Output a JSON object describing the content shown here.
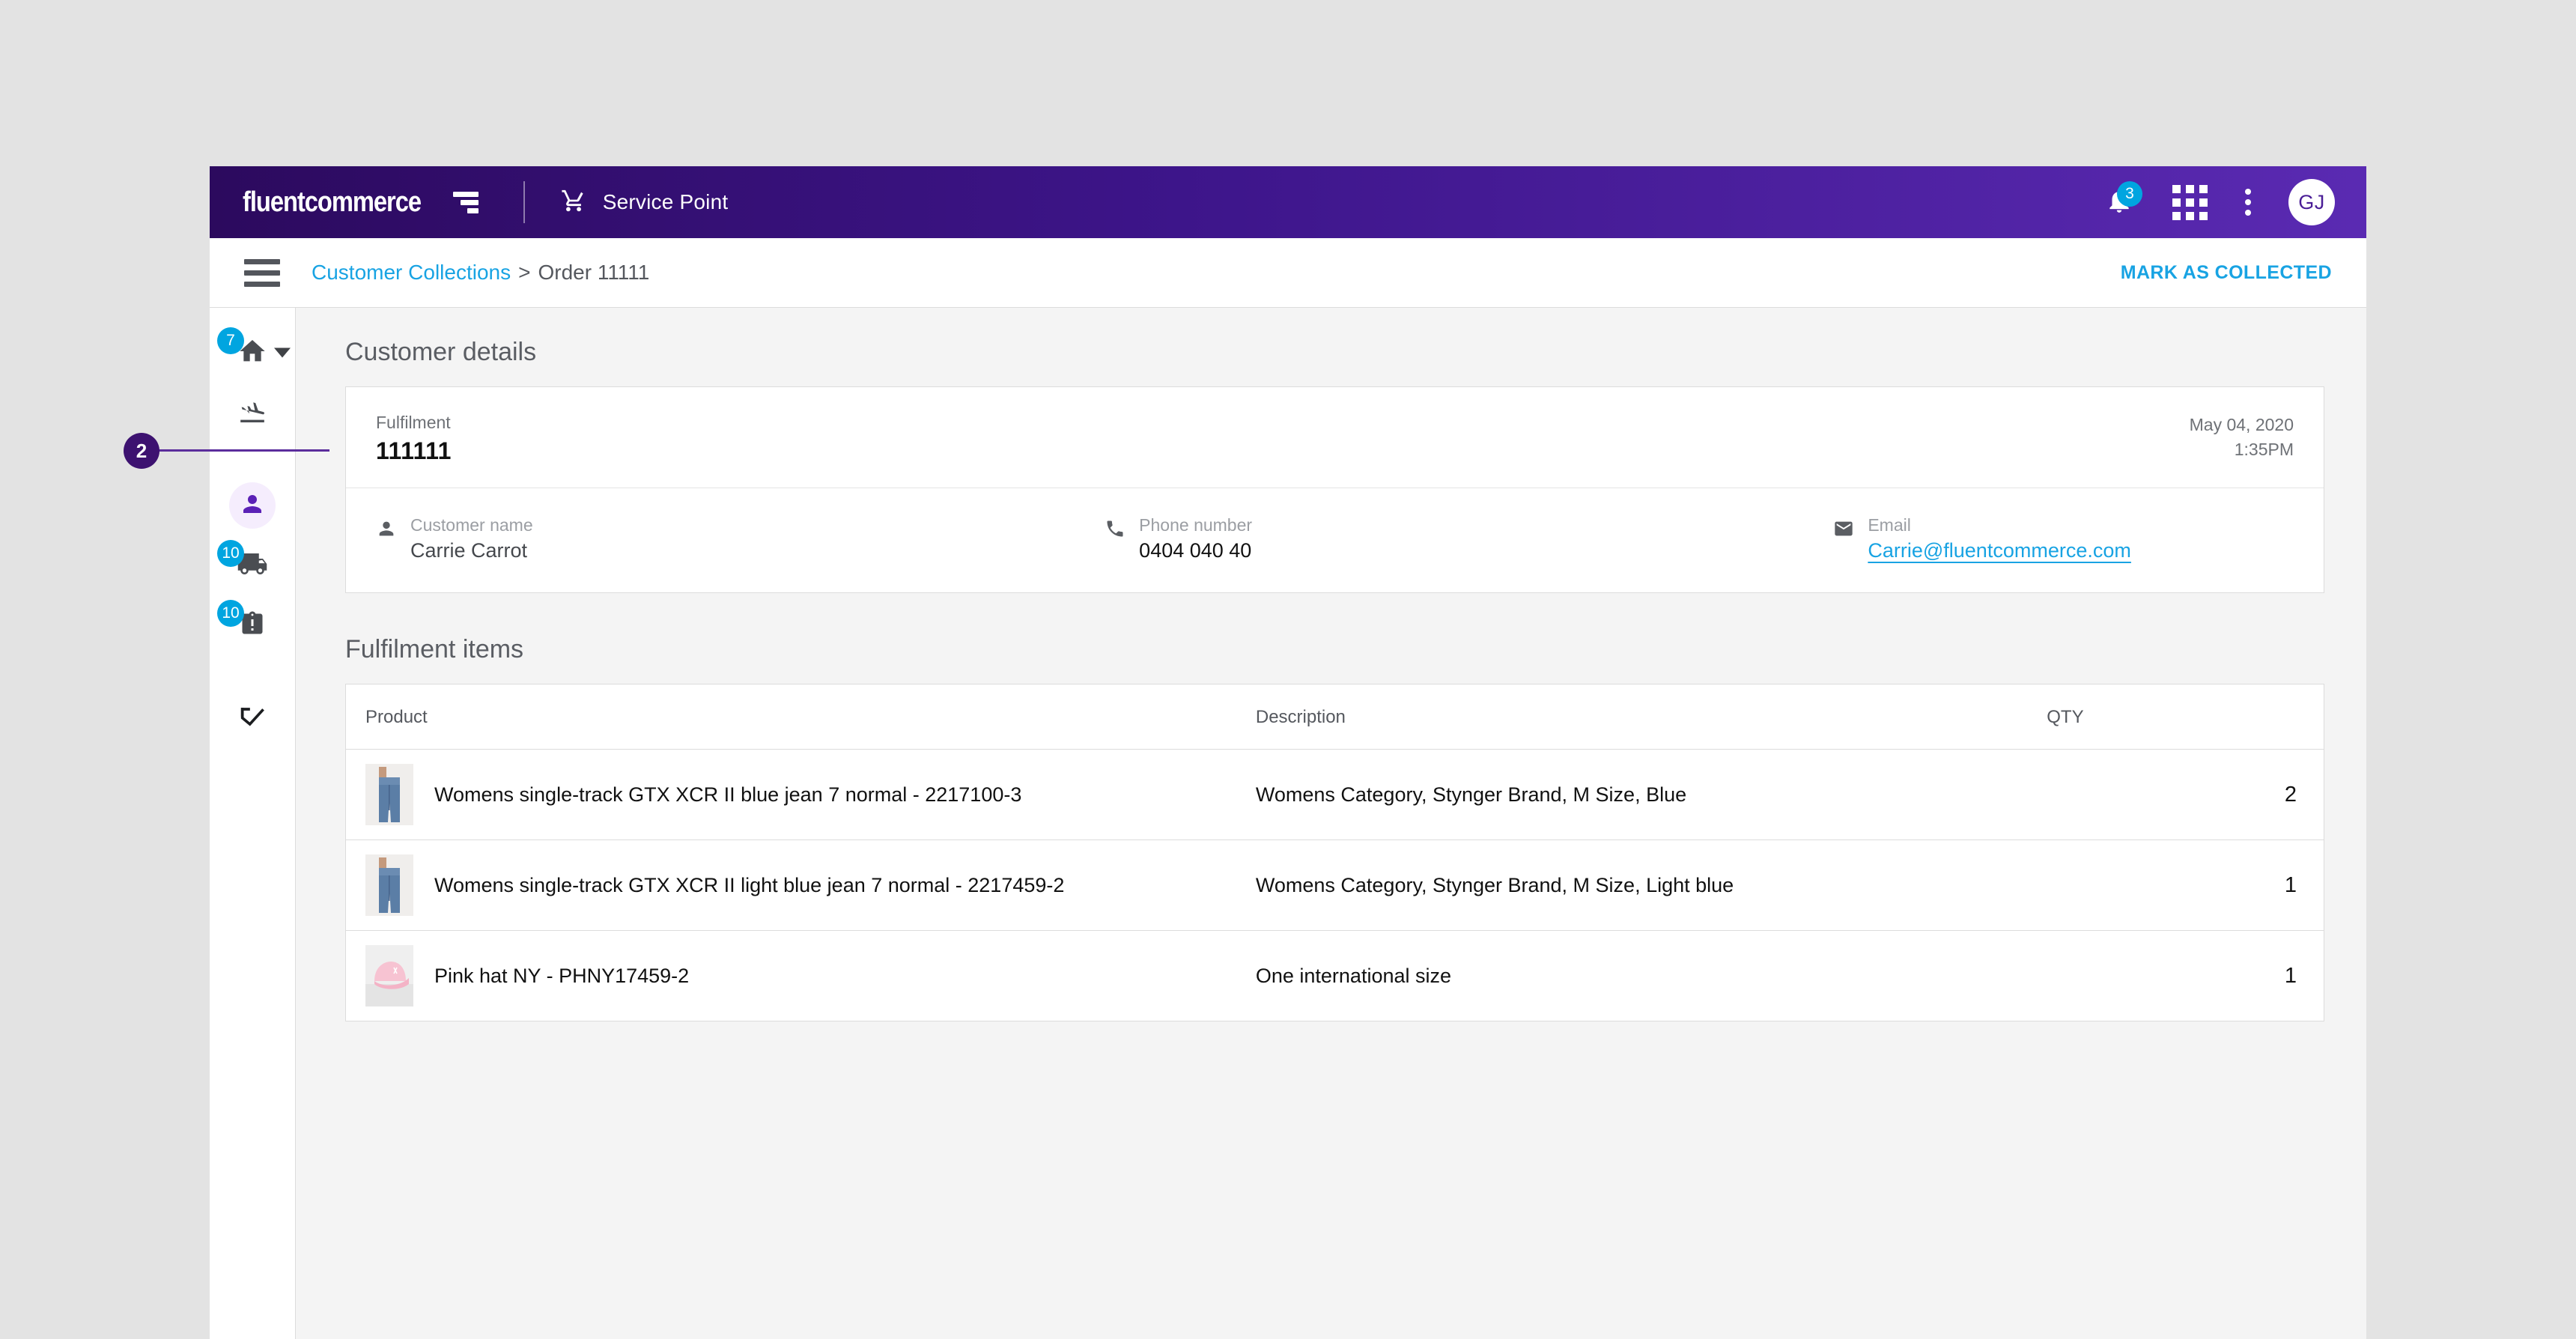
{
  "topbar": {
    "logo_text": "fluentcommerce",
    "logo_mark": "fluent-logo-mark",
    "app_name": "Service Point",
    "cart_icon": "shopping-cart-icon",
    "notification_count": "3",
    "bell_icon": "bell-icon",
    "apps_icon": "apps-grid-icon",
    "overflow_icon": "more-vertical-icon",
    "avatar_initials": "GJ"
  },
  "breadcrumb": {
    "menu_icon": "hamburger-menu-icon",
    "parent": "Customer Collections",
    "separator": ">",
    "current": "Order 11111",
    "action_label": "MARK AS COLLECTED"
  },
  "sidebar": {
    "items": [
      {
        "icon": "home-icon",
        "badge": "7",
        "active": false,
        "has_chevron": true
      },
      {
        "icon": "flight-land-icon",
        "badge": "",
        "active": false,
        "has_chevron": false
      },
      {
        "icon": "person-icon",
        "badge": "",
        "active": true,
        "has_chevron": false
      },
      {
        "icon": "truck-delivery-icon",
        "badge": "10",
        "active": false,
        "has_chevron": false
      },
      {
        "icon": "clipboard-alert-icon",
        "badge": "10",
        "active": false,
        "has_chevron": false
      },
      {
        "icon": "trending-arrow-icon",
        "badge": "",
        "active": false,
        "has_chevron": false
      }
    ]
  },
  "customer_details": {
    "heading": "Customer details",
    "fulfilment_label": "Fulfilment",
    "fulfilment_id": "111111",
    "date": "May 04, 2020",
    "time": "1:35PM",
    "fields": [
      {
        "icon": "person-icon",
        "label": "Customer name",
        "value": "Carrie Carrot",
        "is_link": false
      },
      {
        "icon": "phone-icon",
        "label": "Phone number",
        "value": "0404 040 40",
        "is_link": false
      },
      {
        "icon": "email-icon",
        "label": "Email",
        "value": "Carrie@fluentcommerce.com",
        "is_link": true
      }
    ]
  },
  "fulfilment_items": {
    "heading": "Fulfilment items",
    "columns": {
      "product": "Product",
      "description": "Description",
      "qty": "QTY"
    },
    "rows": [
      {
        "thumb": "blue-jeans-thumbnail",
        "product": "Womens single-track GTX XCR II blue jean 7 normal - 2217100-3",
        "description": "Womens Category, Stynger Brand, M Size, Blue",
        "qty": "2"
      },
      {
        "thumb": "light-blue-jeans-thumbnail",
        "product": "Womens single-track GTX XCR II light blue jean 7 normal - 2217459-2",
        "description": "Womens Category, Stynger Brand, M Size, Light blue",
        "qty": "1"
      },
      {
        "thumb": "pink-hat-thumbnail",
        "product": "Pink hat NY - PHNY17459-2",
        "description": "One international size",
        "qty": "1"
      }
    ]
  },
  "annotation": {
    "number": "2"
  },
  "colors": {
    "brand_purple_dark": "#2c0a5e",
    "brand_purple_light": "#5a2ab2",
    "accent_cyan": "#18a3e3",
    "badge_blue": "#00a5e0",
    "annotation_purple": "#3d1270"
  }
}
